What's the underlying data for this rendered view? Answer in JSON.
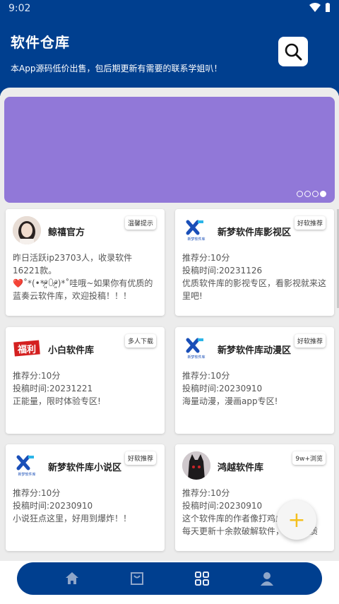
{
  "status_bar": {
    "time": "9:02"
  },
  "header": {
    "title": "软件仓库",
    "subtitle": "本App源码低价出售，包后期更新有需要的联系学姐叭！"
  },
  "colors": {
    "primary": "#003f8f",
    "banner": "#9178d8",
    "fab_plus": "#f4c01e"
  },
  "cards": [
    {
      "name": "鲸禧官方",
      "tag": "温馨提示",
      "lines": [
        "昨日活跃ip23703人，收录软件16221款。",
        "❤️˚*(•*⁰̷̴͈꒨⁰̷̴͈)*˚哇哦~如果你有优质的蓝奏云软件库，欢迎投稿！！！"
      ]
    },
    {
      "name": "新梦软件库影视区",
      "tag": "好软推荐",
      "lines": [
        "推荐分:10分",
        "投稿时间:20231126",
        "优质软件库的影视专区，看影视就来这里吧!"
      ]
    },
    {
      "name": "小白软件库",
      "tag": "多人下载",
      "lines": [
        "推荐分:10分",
        "投稿时间:20231221",
        "正能量，限时体验专区!"
      ]
    },
    {
      "name": "新梦软件库动漫区",
      "tag": "好软推荐",
      "lines": [
        "推荐分:10分",
        "投稿时间:20230910",
        "海量动漫，漫画app专区!"
      ]
    },
    {
      "name": "新梦软件库小说区",
      "tag": "好软推荐",
      "lines": [
        "推荐分:10分",
        "投稿时间:20230910",
        "小说狂点这里，好用到爆炸！！"
      ]
    },
    {
      "name": "鸿越软件库",
      "tag": "9w+浏览",
      "lines": [
        "推荐分:10分",
        "投稿时间:20230910",
        "这个软件库的作者像打鸡血了一样",
        "每天更新十余款破解软件，收录优质"
      ]
    }
  ],
  "logos": {
    "xinmeng_text": "新梦软件库",
    "xiaobai_text": "福利"
  },
  "fab": {
    "label": "+"
  },
  "nav": [
    "home-icon",
    "bag-icon",
    "grid-icon",
    "user-icon"
  ]
}
